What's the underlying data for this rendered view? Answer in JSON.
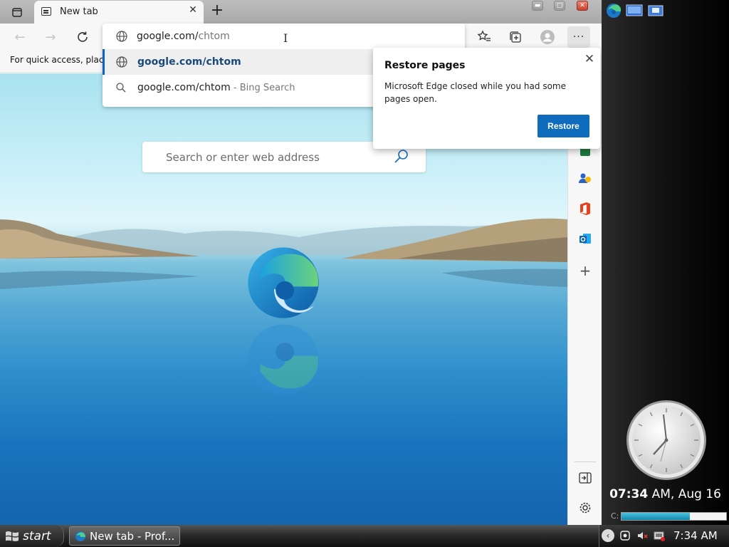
{
  "tab": {
    "title": "New tab"
  },
  "bookmarks": {
    "hint": "For quick access, place y"
  },
  "omnibox": {
    "typed": "google.com/",
    "typed_dim": "chtom",
    "suggestions": [
      {
        "label": "google.com/chtom"
      },
      {
        "label": "google.com/chtom",
        "hint": " - Bing Search"
      }
    ]
  },
  "page": {
    "search_placeholder": "Search or enter web address"
  },
  "restore": {
    "title": "Restore pages",
    "body": "Microsoft Edge closed while you had some pages open.",
    "button": "Restore"
  },
  "desktop": {
    "clock_bold": "07:34",
    "clock_rest": " AM, Aug 16",
    "drive_label": "C:",
    "drive_fill": 0.65
  },
  "taskbar": {
    "start": "start",
    "task_label": "New tab - Prof...",
    "time": "7:34 AM"
  },
  "colors": {
    "accent": "#0f6cbd",
    "edge_blue": "#1365ae"
  }
}
